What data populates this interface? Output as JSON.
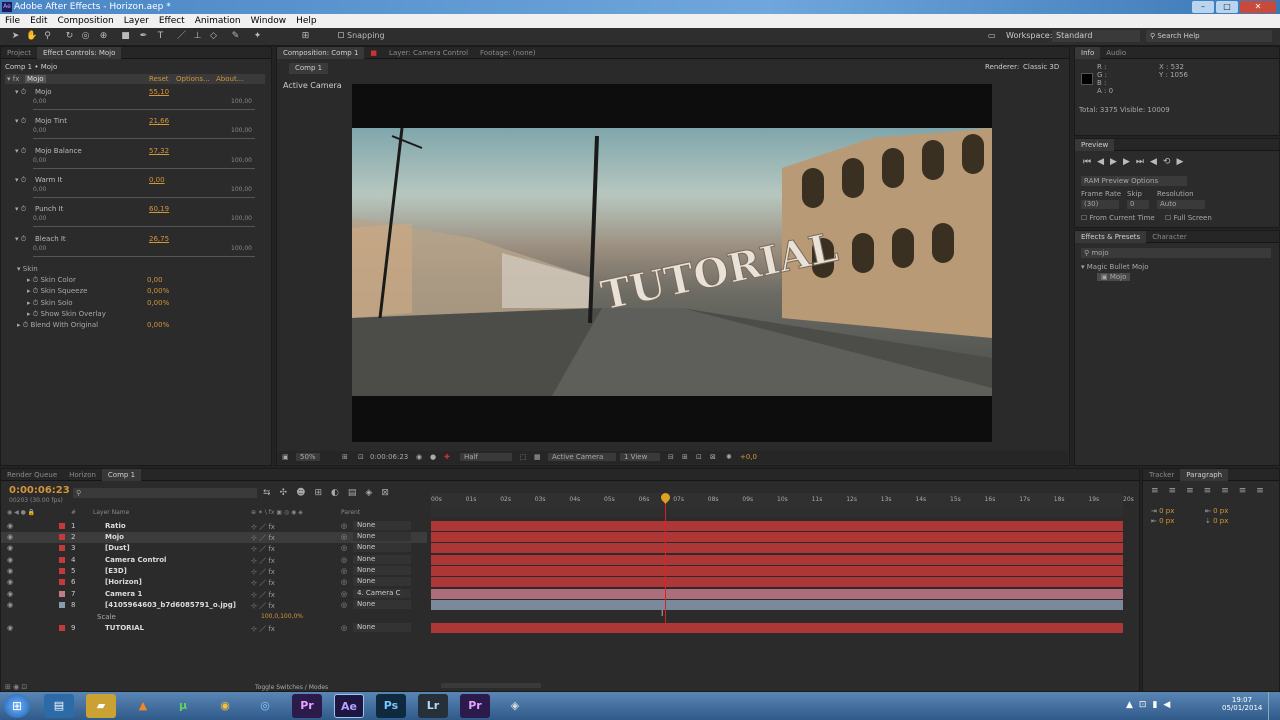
{
  "titlebar": {
    "title": "Adobe After Effects - Horizon.aep *",
    "appicon": "Ae"
  },
  "menu": [
    "File",
    "Edit",
    "Composition",
    "Layer",
    "Effect",
    "Animation",
    "Window",
    "Help"
  ],
  "toolbar": {
    "snapping": "Snapping",
    "workspace_label": "Workspace:",
    "workspace_value": "Standard",
    "search_placeholder": "Search Help"
  },
  "left_panel": {
    "tabs": [
      "Project",
      "Effect Controls: Mojo"
    ],
    "header": "Comp 1 • Mojo",
    "effect": {
      "name": "Mojo",
      "reset": "Reset",
      "options": "Options...",
      "about": "About..."
    },
    "params": [
      {
        "name": "Mojo",
        "value": "55,10",
        "min": "0,00",
        "max": "100,00"
      },
      {
        "name": "Mojo Tint",
        "value": "21,66",
        "min": "0,00",
        "max": "100,00"
      },
      {
        "name": "Mojo Balance",
        "value": "57,32",
        "min": "0,00",
        "max": "100,00"
      },
      {
        "name": "Warm It",
        "value": "0,00",
        "min": "0,00",
        "max": "100,00"
      },
      {
        "name": "Punch It",
        "value": "60,19",
        "min": "0,00",
        "max": "100,00"
      },
      {
        "name": "Bleach It",
        "value": "26,75",
        "min": "0,00",
        "max": "100,00"
      }
    ],
    "skin_group": "Skin",
    "skin": [
      {
        "name": "Skin Color",
        "value": "0,00"
      },
      {
        "name": "Skin Squeeze",
        "value": "0,00%"
      },
      {
        "name": "Skin Solo",
        "value": "0,00%"
      },
      {
        "name": "Show Skin Overlay",
        "value": ""
      }
    ],
    "blend": {
      "name": "Blend With Original",
      "value": "0,00%"
    }
  },
  "center_panel": {
    "tabs": [
      "Composition: Comp 1",
      "Layer: Camera Control",
      "Footage: (none)"
    ],
    "comp_tab": "Comp 1",
    "renderer_label": "Renderer:",
    "renderer_value": "Classic 3D",
    "active_camera": "Active Camera",
    "scene_text": "TUTORIAL",
    "footer": {
      "zoom": "50%",
      "timecode": "0:00:06:23",
      "quality": "Half",
      "camera": "Active Camera",
      "view": "1 View",
      "exposure": "+0,0"
    }
  },
  "info_panel": {
    "tabs": [
      "Info",
      "Audio"
    ],
    "r": "R :",
    "g": "G :",
    "b": "B :",
    "a": "A : 0",
    "x": "X : 532",
    "y": "Y : 1056",
    "total": "Total: 3375  Visible: 10009"
  },
  "preview_panel": {
    "title": "Preview",
    "ram": "RAM Preview Options",
    "frame_rate_label": "Frame Rate",
    "skip_label": "Skip",
    "resolution_label": "Resolution",
    "frame_rate": "(30)",
    "skip": "0",
    "resolution": "Auto",
    "from_current": "From Current Time",
    "full_screen": "Full Screen"
  },
  "effects_panel": {
    "tabs": [
      "Effects & Presets",
      "Character"
    ],
    "search": "mojo",
    "category": "Magic Bullet Mojo",
    "item": "Mojo"
  },
  "timeline": {
    "tabs": [
      "Render Queue",
      "Horizon",
      "Comp 1"
    ],
    "timecode": "0:00:06:23",
    "frames": "00203 (30.00 fps)",
    "col_layer": "Layer Name",
    "col_parent": "Parent",
    "ruler": [
      "00s",
      "01s",
      "02s",
      "03s",
      "04s",
      "05s",
      "06s",
      "07s",
      "08s",
      "09s",
      "10s",
      "11s",
      "12s",
      "13s",
      "14s",
      "15s",
      "16s",
      "17s",
      "18s",
      "19s",
      "20s"
    ],
    "layers": [
      {
        "num": "1",
        "name": "Ratio",
        "parent": "None",
        "color": "#c43a3a"
      },
      {
        "num": "2",
        "name": "Mojo",
        "parent": "None",
        "color": "#c43a3a"
      },
      {
        "num": "3",
        "name": "[Dust]",
        "parent": "None",
        "color": "#c43a3a"
      },
      {
        "num": "4",
        "name": "Camera Control",
        "parent": "None",
        "color": "#c43a3a"
      },
      {
        "num": "5",
        "name": "[E3D]",
        "parent": "None",
        "color": "#c43a3a"
      },
      {
        "num": "6",
        "name": "[Horizon]",
        "parent": "None",
        "color": "#c43a3a"
      },
      {
        "num": "7",
        "name": "Camera 1",
        "parent": "4. Camera C",
        "color": "#c47a8a"
      },
      {
        "num": "8",
        "name": "[4105964603_b7d6085791_o.jpg]",
        "parent": "None",
        "color": "#8a9ab0"
      },
      {
        "num": "9",
        "name": "TUTORIAL",
        "parent": "None",
        "color": "#c43a3a"
      }
    ],
    "scale_label": "Scale",
    "scale_value": "100,0,100,0%",
    "toggle": "Toggle Switches / Modes"
  },
  "right_bottom": {
    "tabs": [
      "Tracker",
      "Paragraph"
    ],
    "px1": "0 px",
    "px2": "0 px",
    "px3": "0 px",
    "px4": "0 px",
    "px5": "0 px"
  },
  "taskbar": {
    "time": "19:07",
    "date": "05/01/2014",
    "apps": [
      "Ps",
      "Lr",
      "Pr",
      "Ae"
    ]
  }
}
